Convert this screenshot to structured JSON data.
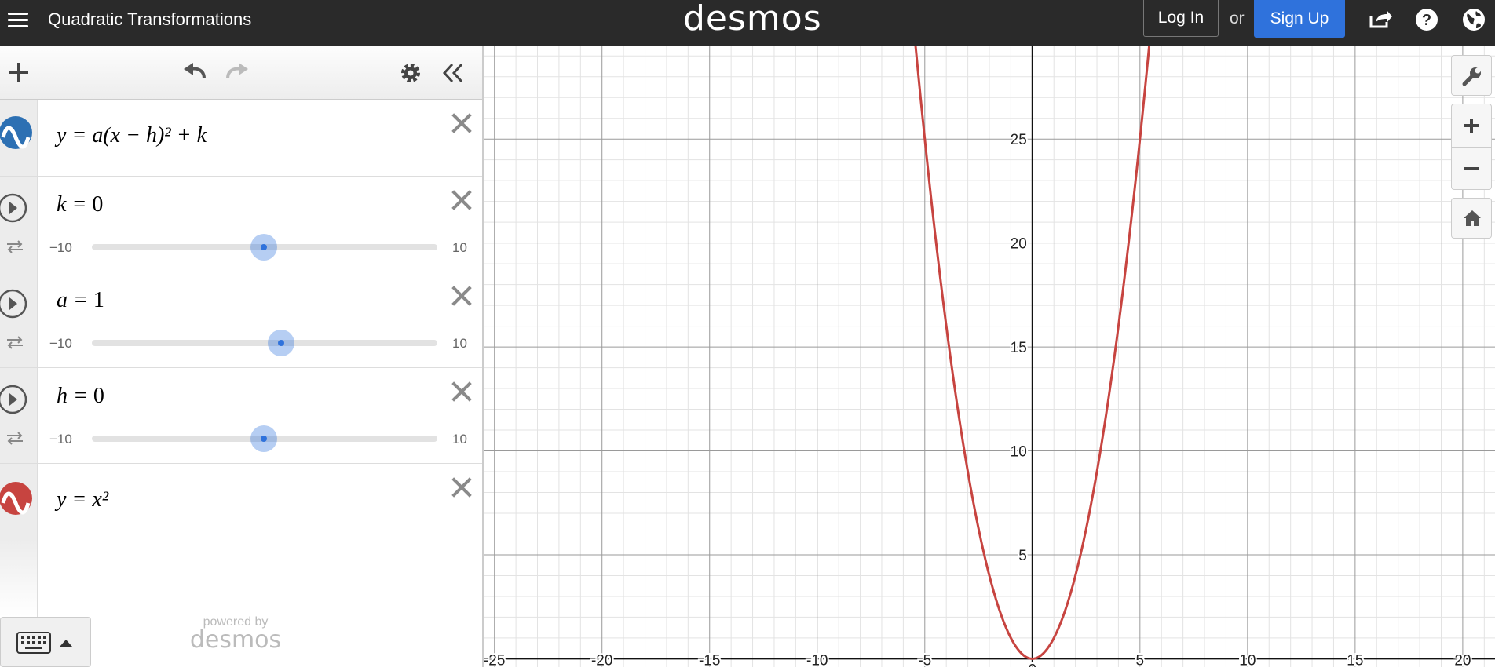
{
  "header": {
    "title": "Quadratic Transformations",
    "brand": "desmos",
    "login_label": "Log In",
    "or_label": "or",
    "signup_label": "Sign Up"
  },
  "expressions": [
    {
      "index": "1",
      "type": "function",
      "color": "#2d70b3",
      "latex": "y = a(x − h)² + k"
    },
    {
      "index": "2",
      "type": "slider",
      "name": "k",
      "value": "0",
      "min": "−10",
      "max": "10",
      "fraction": 0.5
    },
    {
      "index": "3",
      "type": "slider",
      "name": "a",
      "value": "1",
      "min": "−10",
      "max": "10",
      "fraction": 0.55
    },
    {
      "index": "4",
      "type": "slider",
      "name": "h",
      "value": "0",
      "min": "−10",
      "max": "10",
      "fraction": 0.5
    },
    {
      "index": "5",
      "type": "function",
      "color": "#c74440",
      "latex": "y = x²"
    },
    {
      "index": "6",
      "type": "empty"
    }
  ],
  "powered_by": {
    "line1": "powered by",
    "line2": "desmos"
  },
  "graph": {
    "x_range": [
      -25.5,
      21.5
    ],
    "y_range": [
      -0.4,
      29.5
    ],
    "x_tick_labels": [
      "-25",
      "-20",
      "-15",
      "-10",
      "-5",
      "5",
      "10",
      "15",
      "20"
    ],
    "y_tick_labels": [
      "5",
      "10",
      "15",
      "20",
      "25"
    ],
    "origin_label": "0",
    "curve_color": "#c74440",
    "grid": true
  },
  "colors": {
    "accent": "#2f72dc",
    "header_bg": "#2a2a2a"
  }
}
